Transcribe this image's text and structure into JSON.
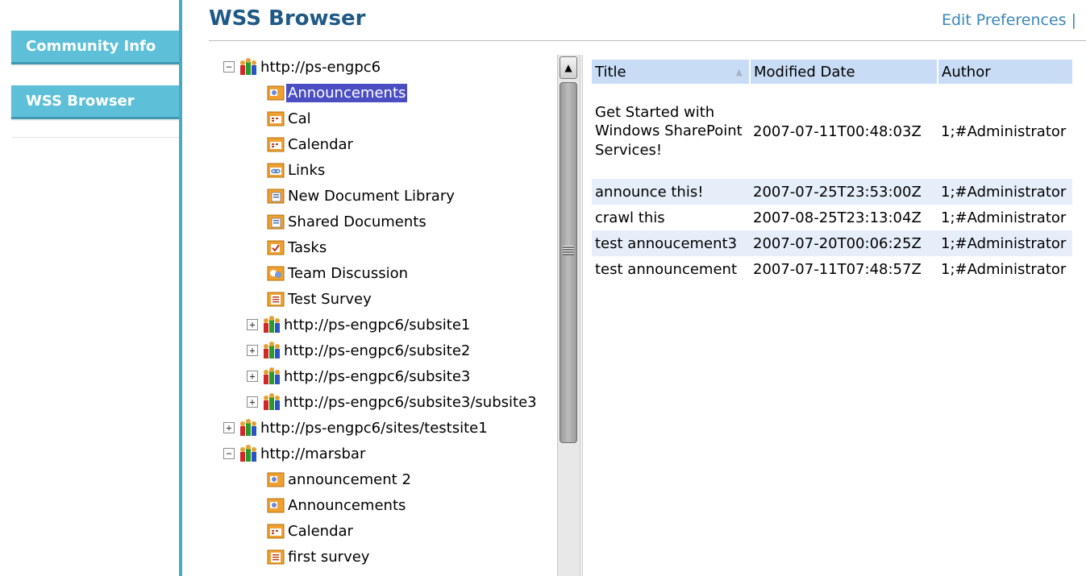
{
  "nav": {
    "items": [
      {
        "label": "Community Info"
      },
      {
        "label": "WSS Browser"
      }
    ]
  },
  "header": {
    "title": "WSS Browser",
    "edit_preferences": "Edit Preferences |"
  },
  "colors": {
    "nav_button": "#5dc0d8",
    "title": "#1f5a86",
    "link": "#3a86ba",
    "selection": "#4b4ec2",
    "grid_header": "#c8dcf6",
    "grid_alt_row": "#e6eefa"
  },
  "tree": {
    "nodes": [
      {
        "label": "http://ps-engpc6",
        "type": "site",
        "expanded": true,
        "toggle": "−",
        "selected": false
      },
      {
        "label": "Announcements",
        "type": "announcements-icon",
        "selected": true
      },
      {
        "label": "Cal",
        "type": "calendar-icon"
      },
      {
        "label": "Calendar",
        "type": "calendar-icon"
      },
      {
        "label": "Links",
        "type": "links-icon"
      },
      {
        "label": "New Document Library",
        "type": "doclib-icon"
      },
      {
        "label": "Shared Documents",
        "type": "doclib-icon"
      },
      {
        "label": "Tasks",
        "type": "tasks-icon"
      },
      {
        "label": "Team Discussion",
        "type": "discussion-icon"
      },
      {
        "label": "Test Survey",
        "type": "survey-icon"
      },
      {
        "label": "http://ps-engpc6/subsite1",
        "type": "site",
        "toggle": "+"
      },
      {
        "label": "http://ps-engpc6/subsite2",
        "type": "site",
        "toggle": "+"
      },
      {
        "label": "http://ps-engpc6/subsite3",
        "type": "site",
        "toggle": "+"
      },
      {
        "label": "http://ps-engpc6/subsite3/subsite3",
        "type": "site",
        "toggle": "+"
      },
      {
        "label": "http://ps-engpc6/sites/testsite1",
        "type": "site",
        "toggle": "+"
      },
      {
        "label": "http://marsbar",
        "type": "site",
        "toggle": "−",
        "expanded": true
      },
      {
        "label": "announcement 2",
        "type": "announcements-icon"
      },
      {
        "label": "Announcements",
        "type": "announcements-icon"
      },
      {
        "label": "Calendar",
        "type": "calendar-icon"
      },
      {
        "label": "first survey",
        "type": "survey-icon"
      }
    ]
  },
  "grid": {
    "columns": [
      "Title",
      "Modified Date",
      "Author"
    ],
    "sort_indicator": "▲",
    "rows": [
      [
        "Get Started with Windows SharePoint Services!",
        "2007-07-11T00:48:03Z",
        "1;#Administrator"
      ],
      [
        "announce this!",
        "2007-07-25T23:53:00Z",
        "1;#Administrator"
      ],
      [
        "crawl this",
        "2007-08-25T23:13:04Z",
        "1;#Administrator"
      ],
      [
        "test annoucement3",
        "2007-07-20T00:06:25Z",
        "1;#Administrator"
      ],
      [
        "test announcement",
        "2007-07-11T07:48:57Z",
        "1;#Administrator"
      ]
    ]
  },
  "scrollbar": {
    "up_arrow": "▲"
  }
}
